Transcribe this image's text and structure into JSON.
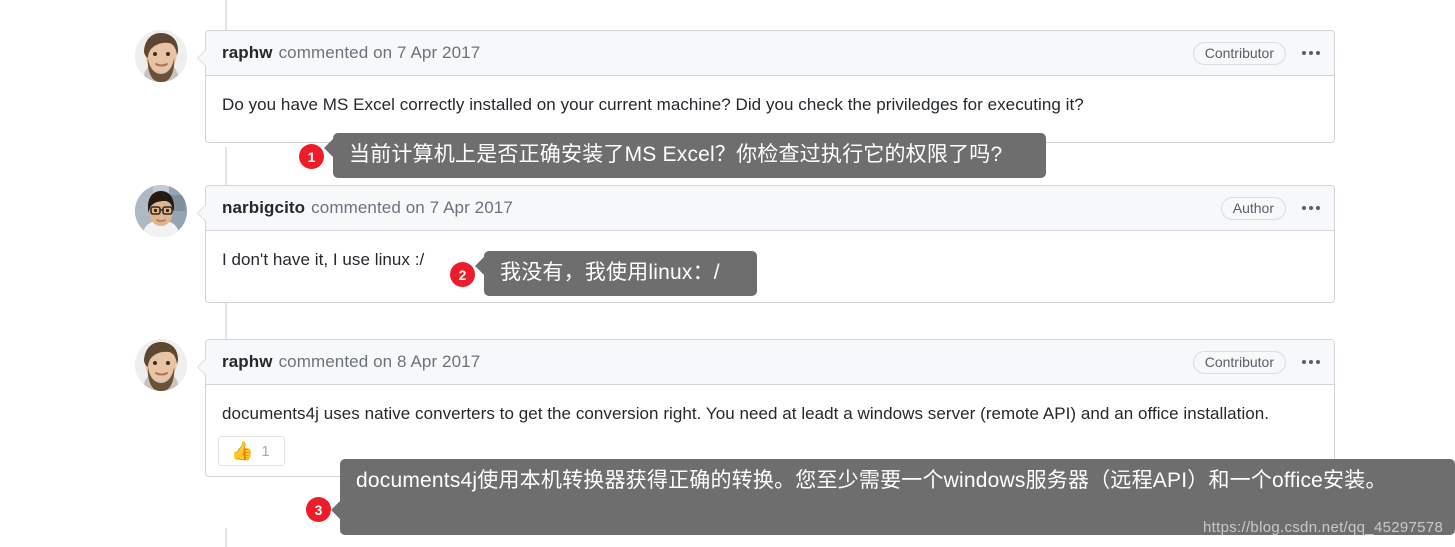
{
  "page": {
    "watermark": "https://blog.csdn.net/qq_45297578"
  },
  "comments": [
    {
      "author": "raphw",
      "meta": "commented on 7 Apr 2017",
      "role_badge": "Contributor",
      "menu_icon": "kebab-menu-icon",
      "avatar_alt": "raphw-avatar",
      "body": "Do you have MS Excel correctly installed on your current machine? Did you check the priviledges for executing it?",
      "translation": {
        "number": "1",
        "text": "当前计算机上是否正确安装了MS Excel？你检查过执行它的权限了吗?"
      }
    },
    {
      "author": "narbigcito",
      "meta": "commented on 7 Apr 2017",
      "role_badge": "Author",
      "menu_icon": "kebab-menu-icon",
      "avatar_alt": "narbigcito-avatar",
      "body": "I don't have it, I use linux :/",
      "translation": {
        "number": "2",
        "text": "我没有，我使用linux：/"
      }
    },
    {
      "author": "raphw",
      "meta": "commented on 8 Apr 2017",
      "role_badge": "Contributor",
      "menu_icon": "kebab-menu-icon",
      "avatar_alt": "raphw-avatar",
      "body": "documents4j uses native converters to get the conversion right. You need at leadt a windows server (remote API) and an office installation.",
      "reaction": {
        "emoji": "👍",
        "emoji_name": "thumbs-up-icon",
        "count": "1"
      },
      "translation": {
        "number": "3",
        "text": "documents4j使用本机转换器获得正确的转换。您至少需要一个windows服务器（远程API）和一个office安装。"
      }
    }
  ],
  "colors": {
    "overlay_bg": "#6e6e6e",
    "badge_red": "#ec1c2a",
    "header_bg": "#f6f8fa",
    "border": "#d1d5da",
    "text": "#24292e",
    "muted": "#6a737d"
  }
}
